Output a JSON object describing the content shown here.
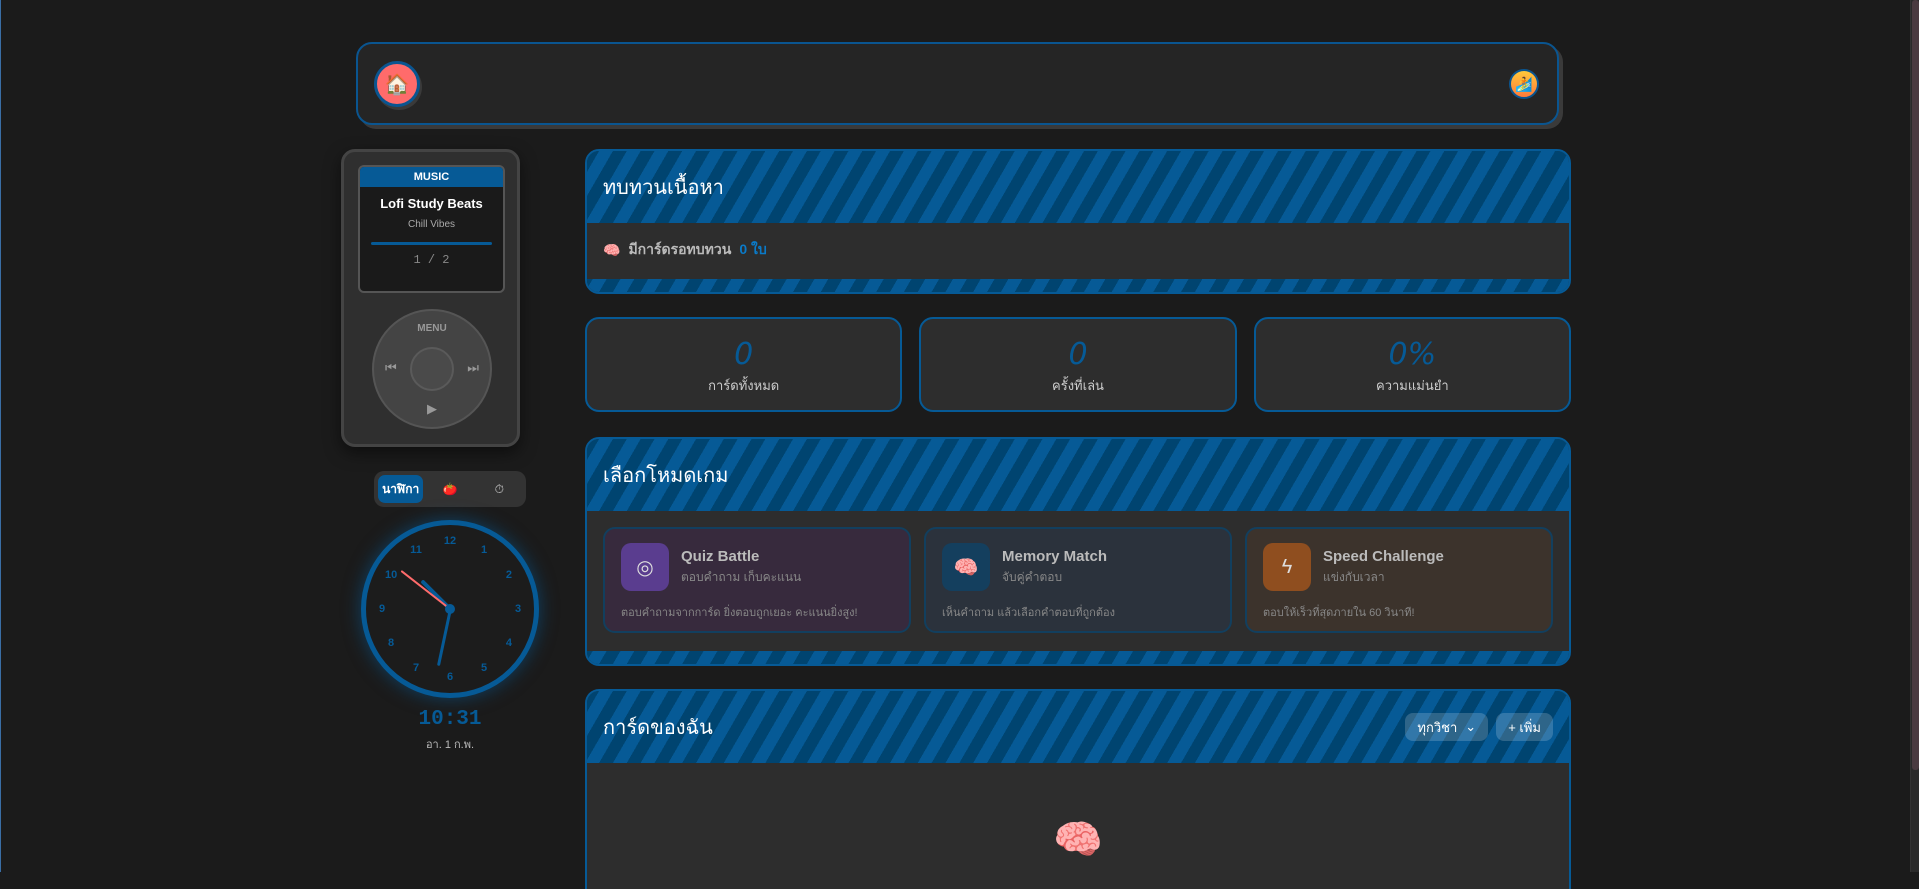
{
  "header": {
    "home_icon": "🏠",
    "avatar_icon": "🏄"
  },
  "music": {
    "label": "MUSIC",
    "title": "Lofi Study Beats",
    "artist": "Chill Vibes",
    "progress": 1.0,
    "track_counter": "1 / 2",
    "menu_label": "MENU"
  },
  "widget_toggle": {
    "items": [
      {
        "label": "นาฬิกา",
        "active": true
      },
      {
        "label": "🍅"
      },
      {
        "label": "⏱"
      }
    ]
  },
  "clock": {
    "numbers": [
      "12",
      "1",
      "2",
      "3",
      "4",
      "5",
      "6",
      "7",
      "8",
      "9",
      "10",
      "11"
    ],
    "digital_time": "10:31",
    "date": "อา. 1 ก.พ."
  },
  "review": {
    "title": "ทบทวนเนื้อหา",
    "prefix": "มีการ์ดรอทบทวน",
    "count": "0 ใบ"
  },
  "stats": [
    {
      "value": "0",
      "label": "การ์ดทั้งหมด"
    },
    {
      "value": "0",
      "label": "ครั้งที่เล่น"
    },
    {
      "value": "0%",
      "label": "ความแม่นยำ"
    }
  ],
  "game_modes": {
    "title": "เลือกโหมดเกม",
    "items": [
      {
        "name": "Quiz Battle",
        "subtitle": "ตอบคำถาม เก็บคะแนน",
        "description": "ตอบคำถามจากการ์ด ยิ่งตอบถูกเยอะ คะแนนยิ่งสูง!",
        "icon": "◎",
        "color": "#5a3d8f",
        "bg": "#372a3d"
      },
      {
        "name": "Memory Match",
        "subtitle": "จับคู่คำตอบ",
        "description": "เห็นคำถาม แล้วเลือกคำตอบที่ถูกต้อง",
        "icon": "🧠",
        "color": "#143f5e",
        "bg": "#2b323c"
      },
      {
        "name": "Speed Challenge",
        "subtitle": "แข่งกับเวลา",
        "description": "ตอบให้เร็วที่สุดภายใน 60 วินาที!",
        "icon": "ϟ",
        "color": "#8f4e1f",
        "bg": "#3c332c"
      }
    ]
  },
  "my_cards": {
    "title": "การ์ดของฉัน",
    "filter": "ทุกวิชา",
    "add": "+ เพิ่ม",
    "empty_icon": "brain-icon"
  }
}
